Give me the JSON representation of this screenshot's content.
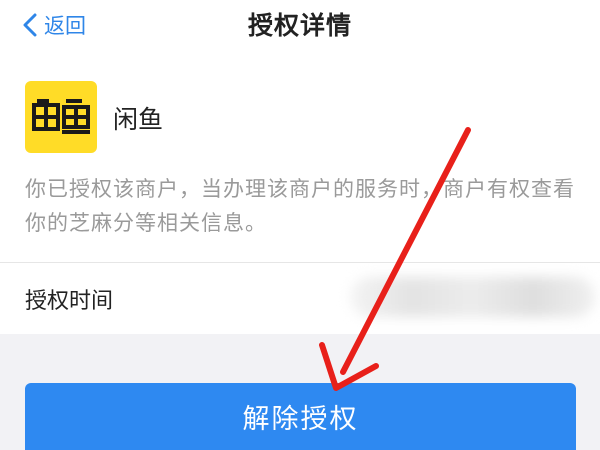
{
  "header": {
    "back_label": "返回",
    "title": "授权详情"
  },
  "merchant": {
    "logo_icon": "xianyu-logo-icon",
    "logo_color": "#ffdc27",
    "name": "闲鱼",
    "description": "你已授权该商户，当办理该商户的服务时，商户有权查看你的芝麻分等相关信息。"
  },
  "auth_time": {
    "label": "授权时间"
  },
  "actions": {
    "revoke_label": "解除授权"
  },
  "colors": {
    "accent": "#2e89f1",
    "link": "#2f86e8",
    "annotation": "#e8201a"
  }
}
